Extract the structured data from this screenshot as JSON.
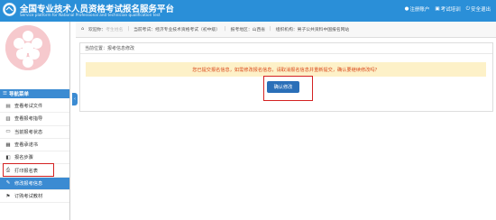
{
  "header": {
    "title": "全国专业技术人员资格考试报名服务平台",
    "subtitle": "Service platform for National Professional and technician qualification test",
    "links": [
      {
        "label": "注册账户",
        "icon": "user-icon"
      },
      {
        "label": "考试培训",
        "icon": "book-icon"
      },
      {
        "label": "安全退出",
        "icon": "logout-icon"
      }
    ]
  },
  "infobar": {
    "welcome_prefix": "欢迎你：",
    "welcome_name": "考生姓名",
    "exam": "当前考试：经济专业技术资格考试（初中级）",
    "area": "报考地区：山西省",
    "agency": "组织机构：男子公共资料中国报名网站"
  },
  "sidebar": {
    "nav_title": "导航菜单",
    "items": [
      {
        "label": "查看考试文件",
        "icon": "file-icon"
      },
      {
        "label": "查看报考指导",
        "icon": "book-icon"
      },
      {
        "label": "当前报考状态",
        "icon": "monitor-icon"
      },
      {
        "label": "查看承诺书",
        "icon": "doc-icon"
      },
      {
        "label": "报名步骤",
        "icon": "steps-icon"
      },
      {
        "label": "打印报名表",
        "icon": "print-icon"
      },
      {
        "label": "修改报考信息",
        "icon": "edit-icon"
      },
      {
        "label": "订购考试教材",
        "icon": "flag-icon"
      }
    ],
    "active_index": 6
  },
  "main": {
    "breadcrumb": "当前位置：报考信息修改",
    "warning": "您已提交报名信息，如需修改报名信息，请取消报名信息并重新提交，确认要继续修改吗？",
    "confirm_label": "确认修改"
  },
  "colors": {
    "header_blue": "#2a8fd8",
    "nav_blue": "#3b8bd2",
    "warning_bg": "#fdf1c8",
    "warning_text": "#d9481a",
    "highlight_red": "#d42222"
  }
}
